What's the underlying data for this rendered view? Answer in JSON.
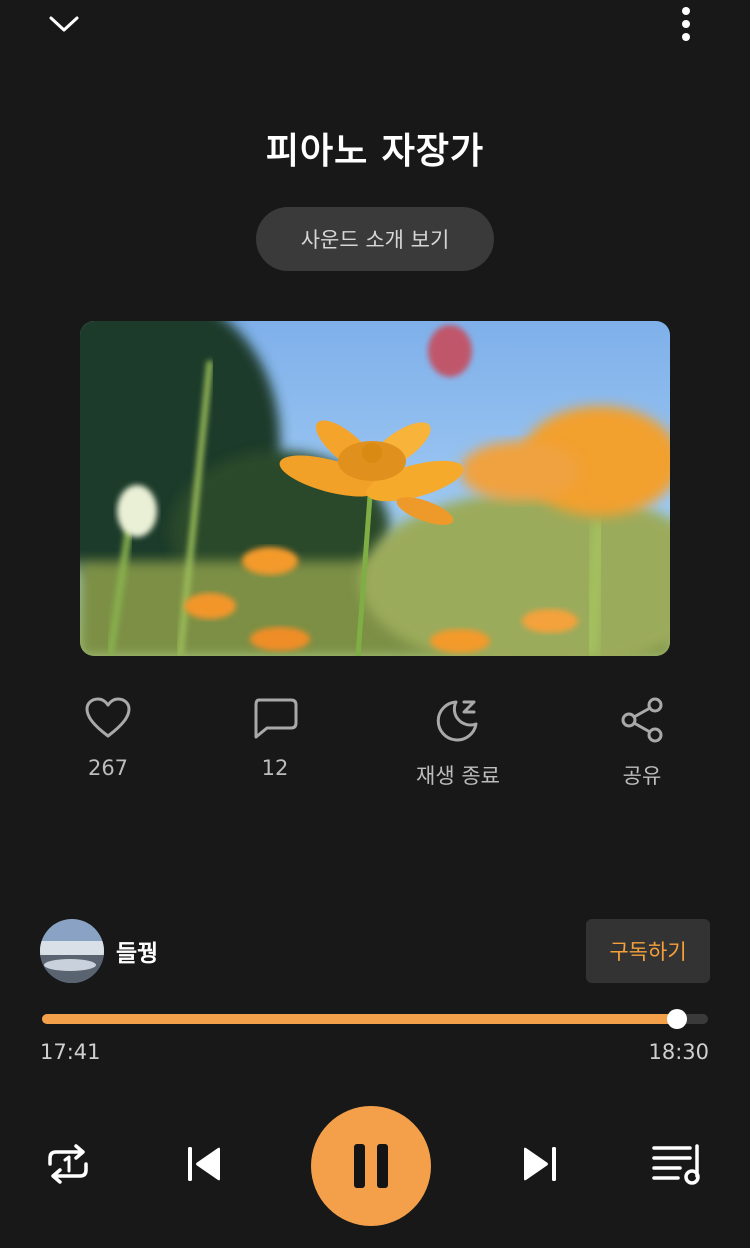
{
  "header": {
    "title": "피아노 자장가",
    "intro_button": "사운드 소개 보기"
  },
  "actions": {
    "like_count": "267",
    "comment_count": "12",
    "sleep_timer_label": "재생 종료",
    "share_label": "공유"
  },
  "creator": {
    "name": "들꿩",
    "subscribe_label": "구독하기"
  },
  "player": {
    "current_time": "17:41",
    "total_time": "18:30",
    "progress": 0.953,
    "state": "playing"
  },
  "icons": {
    "collapse": "chevron-down-icon",
    "more": "more-vertical-icon",
    "like": "heart-icon",
    "comment": "comment-icon",
    "sleep": "moon-sleep-icon",
    "share": "share-icon",
    "repeat": "repeat-one-icon",
    "previous": "skip-previous-icon",
    "pause": "pause-icon",
    "next": "skip-next-icon",
    "playlist": "playlist-icon"
  },
  "colors": {
    "accent": "#f4a04b",
    "background": "#181818",
    "subscribe_text": "#f5a03a"
  }
}
